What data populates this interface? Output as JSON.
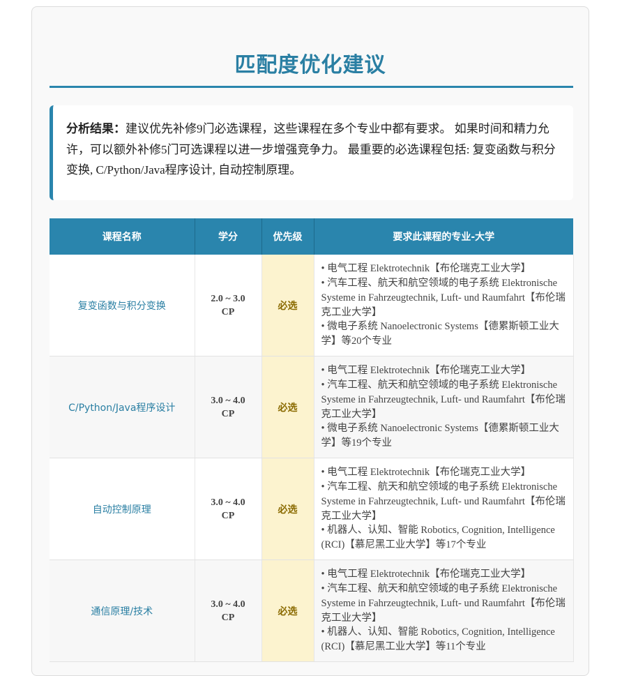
{
  "page": {
    "title": "匹配度优化建议"
  },
  "summary": {
    "lead": "分析结果：",
    "text": "建议优先补修9门必选课程，这些课程在多个专业中都有要求。 如果时间和精力允许，可以额外补修5门可选课程以进一步增强竞争力。 最重要的必选课程包括: 复变函数与积分变换, C/Python/Java程序设计, 自动控制原理。"
  },
  "table": {
    "headers": [
      "课程名称",
      "学分",
      "优先级",
      "要求此课程的专业-大学"
    ],
    "rows": [
      {
        "name": "复变函数与积分变换",
        "cp_range": "2.0 ~ 3.0",
        "cp_unit": "CP",
        "priority": "必选",
        "requirements": [
          "• 电气工程 Elektrotechnik【布伦瑞克工业大学】",
          "• 汽车工程、航天和航空领域的电子系统 Elektronische Systeme in Fahrzeugtechnik, Luft- und Raumfahrt【布伦瑞克工业大学】",
          "• 微电子系统 Nanoelectronic Systems【德累斯顿工业大学】等20个专业"
        ]
      },
      {
        "name": "C/Python/Java程序设计",
        "cp_range": "3.0 ~ 4.0",
        "cp_unit": "CP",
        "priority": "必选",
        "requirements": [
          "• 电气工程 Elektrotechnik【布伦瑞克工业大学】",
          "• 汽车工程、航天和航空领域的电子系统 Elektronische Systeme in Fahrzeugtechnik, Luft- und Raumfahrt【布伦瑞克工业大学】",
          "• 微电子系统 Nanoelectronic Systems【德累斯顿工业大学】等19个专业"
        ]
      },
      {
        "name": "自动控制原理",
        "cp_range": "3.0 ~ 4.0",
        "cp_unit": "CP",
        "priority": "必选",
        "requirements": [
          "• 电气工程 Elektrotechnik【布伦瑞克工业大学】",
          "• 汽车工程、航天和航空领域的电子系统 Elektronische Systeme in Fahrzeugtechnik, Luft- und Raumfahrt【布伦瑞克工业大学】",
          "• 机器人、认知、智能 Robotics, Cognition, Intelligence (RCI)【慕尼黑工业大学】等17个专业"
        ]
      },
      {
        "name": "通信原理/技术",
        "cp_range": "3.0 ~ 4.0",
        "cp_unit": "CP",
        "priority": "必选",
        "requirements": [
          "• 电气工程 Elektrotechnik【布伦瑞克工业大学】",
          "• 汽车工程、航天和航空领域的电子系统 Elektronische Systeme in Fahrzeugtechnik, Luft- und Raumfahrt【布伦瑞克工业大学】",
          "• 机器人、认知、智能 Robotics, Cognition, Intelligence (RCI)【慕尼黑工业大学】等11个专业"
        ]
      }
    ]
  },
  "colors": {
    "accent": "#2a85ad",
    "title": "#2a7fa3",
    "priority_bg": "#fcf3cf",
    "priority_text": "#8a6a00"
  }
}
